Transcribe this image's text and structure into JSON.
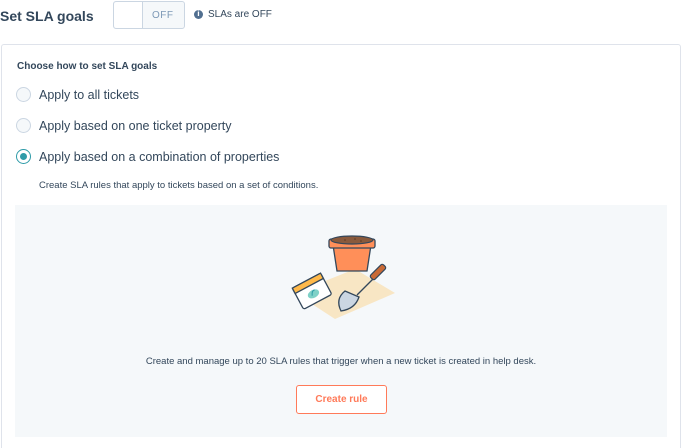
{
  "header": {
    "title": "Set SLA goals",
    "toggle_label": "OFF",
    "status_text": "SLAs are OFF"
  },
  "panel": {
    "section_title": "Choose how to set SLA goals",
    "options": [
      {
        "label": "Apply to all tickets",
        "selected": false
      },
      {
        "label": "Apply based on one ticket property",
        "selected": false
      },
      {
        "label": "Apply based on a combination of properties",
        "selected": true
      }
    ],
    "description": "Create SLA rules that apply to tickets based on a set of conditions."
  },
  "empty_state": {
    "illustration": "garden-pot-trowel-seeds",
    "message": "Create and manage up to 20 SLA rules that trigger when a new ticket is created in help desk.",
    "button_label": "Create rule"
  },
  "colors": {
    "accent_teal": "#2e9ba8",
    "cta_orange": "#ff7a59",
    "text": "#33475b",
    "empty_bg": "#f5f8fa"
  }
}
